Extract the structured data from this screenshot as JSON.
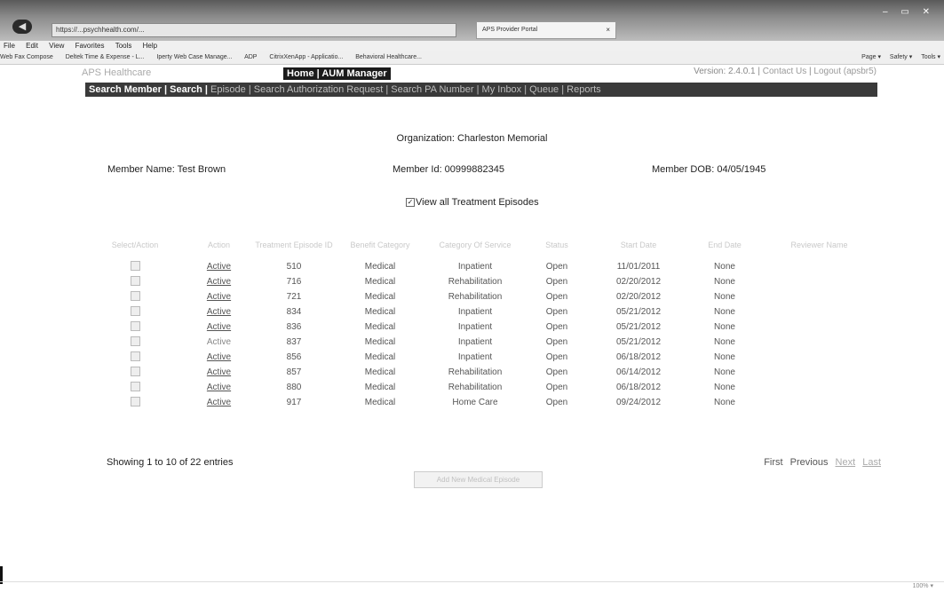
{
  "browser": {
    "address": "https://...psychhealth.com/...",
    "tab_title": "APS Provider Portal",
    "tab_close": "×",
    "window_controls": "– ▭ ✕",
    "menu": [
      "File",
      "Edit",
      "View",
      "Favorites",
      "Tools",
      "Help"
    ],
    "favorites": [
      "Web Fax Compose",
      "Deltek Time & Expense - L...",
      "Iperty Web Case Manage...",
      "ADP",
      "CitrixXenApp - Applicatio...",
      "Behavioral Healthcare..."
    ],
    "toolbar_right": [
      "Page ▾",
      "Safety ▾",
      "Tools ▾"
    ],
    "zoom": "100% ▾"
  },
  "header": {
    "logo": "APS Healthcare",
    "home_nav": "Home | AUM Manager",
    "version": "Version: 2.4.0.1",
    "contact": "Contact Us",
    "logout": "Logout (apsbr5)"
  },
  "navbar": {
    "active": "Search Member | Search |",
    "items": "Episode | Search Authorization Request | Search PA Number | My Inbox | Queue | Reports"
  },
  "organization": "Organization: Charleston Memorial",
  "member": {
    "name": "Member Name: Test Brown",
    "id": "Member Id: 00999882345",
    "dob": "Member DOB: 04/05/1945"
  },
  "view_all": "View all Treatment Episodes",
  "table": {
    "headers": [
      "Select/Action",
      "Action",
      "Treatment Episode ID",
      "Benefit Category",
      "Category Of Service",
      "Status",
      "Start Date",
      "End Date",
      "Reviewer Name"
    ],
    "rows": [
      {
        "action": "Active",
        "id": "510",
        "benefit": "Medical",
        "service": "Inpatient",
        "status": "Open",
        "start": "11/01/2011",
        "end": "None"
      },
      {
        "action": "Active",
        "id": "716",
        "benefit": "Medical",
        "service": "Rehabilitation",
        "status": "Open",
        "start": "02/20/2012",
        "end": "None"
      },
      {
        "action": "Active",
        "id": "721",
        "benefit": "Medical",
        "service": "Rehabilitation",
        "status": "Open",
        "start": "02/20/2012",
        "end": "None"
      },
      {
        "action": "Active",
        "id": "834",
        "benefit": "Medical",
        "service": "Inpatient",
        "status": "Open",
        "start": "05/21/2012",
        "end": "None"
      },
      {
        "action": "Active",
        "id": "836",
        "benefit": "Medical",
        "service": "Inpatient",
        "status": "Open",
        "start": "05/21/2012",
        "end": "None"
      },
      {
        "action": "Active",
        "id": "837",
        "benefit": "Medical",
        "service": "Inpatient",
        "status": "Open",
        "start": "05/21/2012",
        "end": "None"
      },
      {
        "action": "Active",
        "id": "856",
        "benefit": "Medical",
        "service": "Inpatient",
        "status": "Open",
        "start": "06/18/2012",
        "end": "None"
      },
      {
        "action": "Active",
        "id": "857",
        "benefit": "Medical",
        "service": "Rehabilitation",
        "status": "Open",
        "start": "06/14/2012",
        "end": "None"
      },
      {
        "action": "Active",
        "id": "880",
        "benefit": "Medical",
        "service": "Rehabilitation",
        "status": "Open",
        "start": "06/18/2012",
        "end": "None"
      },
      {
        "action": "Active",
        "id": "917",
        "benefit": "Medical",
        "service": "Home Care",
        "status": "Open",
        "start": "09/24/2012",
        "end": "None"
      }
    ]
  },
  "pagination": {
    "summary": "Showing 1 to 10 of 22 entries",
    "first": "First",
    "previous": "Previous",
    "next": "Next",
    "last": "Last"
  },
  "new_button": "Add New Medical Episode"
}
